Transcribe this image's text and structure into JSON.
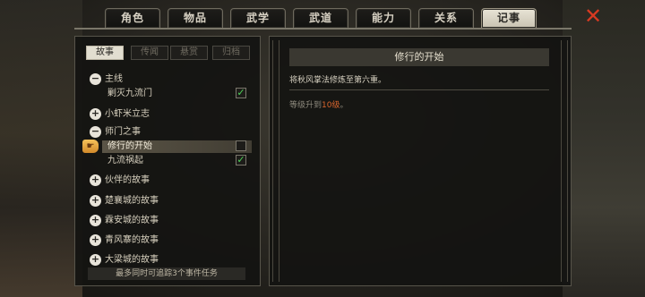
{
  "tabs": [
    {
      "label": "角色"
    },
    {
      "label": "物品"
    },
    {
      "label": "武学"
    },
    {
      "label": "武道"
    },
    {
      "label": "能力"
    },
    {
      "label": "关系"
    },
    {
      "label": "记事"
    }
  ],
  "active_tab": "记事",
  "filters": [
    {
      "label": "故事"
    },
    {
      "label": "传闻"
    },
    {
      "label": "悬赏"
    },
    {
      "label": "归档"
    }
  ],
  "tree": {
    "main": {
      "label": "主线",
      "expander": "−"
    },
    "main_child": {
      "label": "剿灭九流门",
      "check": "✓"
    },
    "shrimp": {
      "label": "小虾米立志",
      "expander": "+"
    },
    "sect": {
      "label": "师门之事",
      "expander": "−"
    },
    "sect_child1": {
      "label": "修行的开始",
      "check": ""
    },
    "sect_child2": {
      "label": "九流祸起",
      "check": "✓"
    },
    "partners": {
      "label": "伙伴的故事",
      "expander": "+"
    },
    "chuxiang": {
      "label": "楚襄城的故事",
      "expander": "+"
    },
    "lin_an": {
      "label": "霖安城的故事",
      "expander": "+"
    },
    "qingfeng": {
      "label": "青风寨的故事",
      "expander": "+"
    },
    "daliang": {
      "label": "大梁城的故事",
      "expander": "+"
    }
  },
  "footer_note": "最多同时可追踪3个事件任务",
  "detail": {
    "title": "修行的开始",
    "description": "将秋风掌法修炼至第六重。",
    "level_prefix": "等级升到",
    "level_value": "10级",
    "level_suffix": "。"
  },
  "pointer_icon": "☛",
  "close_icon": "✕",
  "colors": {
    "accent_red": "#d83a22",
    "check_green": "#4fd35a",
    "level_highlight": "#d9652e",
    "notification_dot": "#e04a2a"
  }
}
